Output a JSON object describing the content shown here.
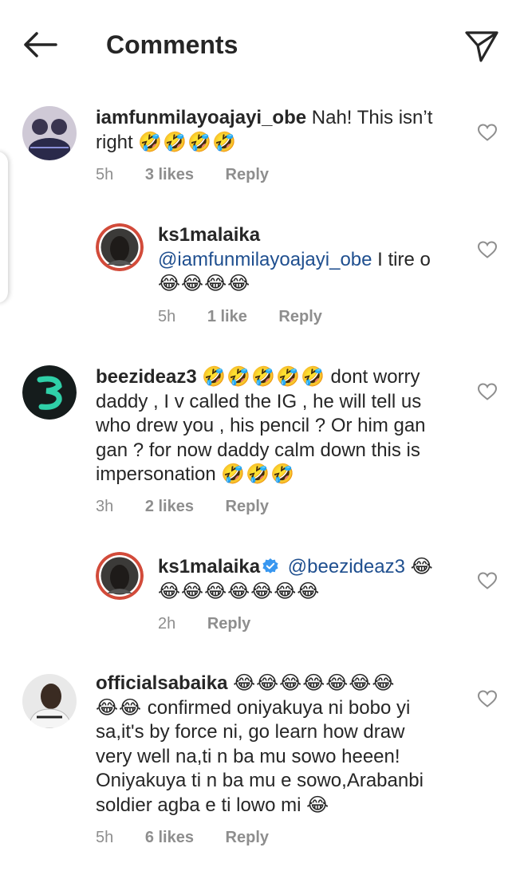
{
  "header": {
    "title": "Comments",
    "back_icon": "arrow-left-icon",
    "share_icon": "paper-plane-icon"
  },
  "colors": {
    "text": "#262626",
    "secondary": "#8e8e8e",
    "mention": "#1f4f8f",
    "verified": "#3897f0"
  },
  "comments": [
    {
      "username": "iamfunmilayoajayi_obe",
      "text_line1": "Nah! This isn’t",
      "text_line2": "right",
      "emoji_line2": "🤣🤣🤣🤣",
      "time": "5h",
      "likes": "3 likes",
      "reply": "Reply"
    },
    {
      "username": "ks1malaika",
      "mention": "@iamfunmilayoajayi_obe",
      "text_after_mention": "I tire o",
      "emoji_line": "😂😂😂😂",
      "time": "5h",
      "likes": "1 like",
      "reply": "Reply"
    },
    {
      "username": "beezideaz3",
      "emoji_start": "🤣🤣🤣🤣🤣",
      "line1_text": "dont worry",
      "line2": "daddy , I v called the  IG , he will tell us",
      "line3": "who drew you , his pencil ? Or him gan",
      "line4": "gan ? for now daddy calm down this is",
      "line5_text": "impersonation",
      "line5_emoji": "🤣🤣🤣",
      "time": "3h",
      "likes": "2 likes",
      "reply": "Reply"
    },
    {
      "username": "ks1malaika",
      "verified": true,
      "mention": "@beezideaz3",
      "emoji_end": "😂",
      "emoji_line2": "😂😂😂😂😂😂😂",
      "time": "2h",
      "reply": "Reply"
    },
    {
      "username": "officialsabaika",
      "emoji_line1": "😂😂😂😂😂😂😂",
      "line2_emoji": "😂😂",
      "line2_text": "confirmed oniyakuya ni bobo yi",
      "line3": "sa,it's by force ni, go learn how draw",
      "line4": "very well na,ti n ba mu sowo heeen!",
      "line5": "Oniyakuya ti n ba mu e sowo,Arabanbi",
      "line6_text": "soldier agba e ti lowo mi",
      "line6_emoji": "😂",
      "time": "5h",
      "likes": "6 likes",
      "reply": "Reply"
    }
  ]
}
